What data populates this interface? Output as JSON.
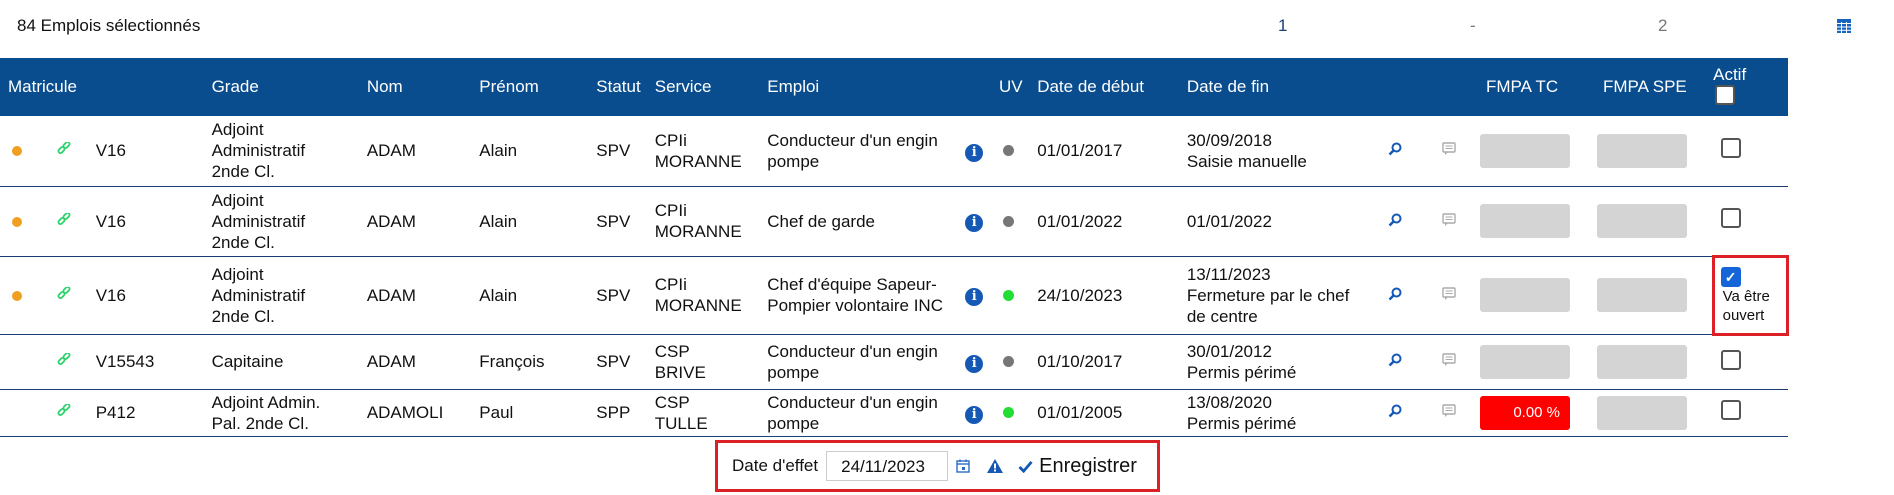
{
  "topbar": {
    "count_label": "84 Emplois sélectionnés",
    "page1": "1",
    "sep": "-",
    "page2": "2"
  },
  "columns": [
    "Matricule",
    "Grade",
    "Nom",
    "Prénom",
    "Statut",
    "Service",
    "Emploi",
    "UV",
    "Date de début",
    "Date de fin",
    "FMPA TC",
    "FMPA SPE",
    "Actif"
  ],
  "rows": [
    {
      "matricule": "V16",
      "grade": "Adjoint Administratif 2nde Cl.",
      "nom": "ADAM",
      "prenom": "Alain",
      "statut": "SPV",
      "service": "CPIi MORANNE",
      "emploi": "Conducteur d'un engin pompe",
      "uv_status": "grey",
      "date_debut": "01/01/2017",
      "date_fin": "30/09/2018",
      "date_fin_note": "Saisie manuelle",
      "fmpa_tc": "",
      "fmpa_spe": "",
      "actif": false
    },
    {
      "matricule": "V16",
      "grade": "Adjoint Administratif 2nde Cl.",
      "nom": "ADAM",
      "prenom": "Alain",
      "statut": "SPV",
      "service": "CPIi MORANNE",
      "emploi": "Chef de garde",
      "uv_status": "grey",
      "date_debut": "01/01/2022",
      "date_fin": "01/01/2022",
      "date_fin_note": "",
      "fmpa_tc": "",
      "fmpa_spe": "",
      "actif": false
    },
    {
      "matricule": "V16",
      "grade": "Adjoint Administratif 2nde Cl.",
      "nom": "ADAM",
      "prenom": "Alain",
      "statut": "SPV",
      "service": "CPIi MORANNE",
      "emploi": "Chef d'équipe Sapeur-Pompier volontaire INC",
      "uv_status": "green",
      "date_debut": "24/10/2023",
      "date_fin": "13/11/2023",
      "date_fin_note": "Fermeture par le chef de centre",
      "fmpa_tc": "",
      "fmpa_spe": "",
      "actif": true,
      "actif_note": "Va être ouvert"
    },
    {
      "matricule": "V15543",
      "grade": "Capitaine",
      "nom": "ADAM",
      "prenom": "François",
      "statut": "SPV",
      "service": "CSP BRIVE",
      "emploi": "Conducteur d'un engin pompe",
      "uv_status": "grey",
      "date_debut": "01/10/2017",
      "date_fin": "30/01/2012",
      "date_fin_note": "Permis périmé",
      "fmpa_tc": "",
      "fmpa_spe": "",
      "actif": false
    },
    {
      "matricule": "P412",
      "grade": "Adjoint Admin. Pal. 2nde Cl.",
      "nom": "ADAMOLI",
      "prenom": "Paul",
      "statut": "SPP",
      "service": "CSP TULLE",
      "emploi": "Conducteur d'un engin pompe",
      "uv_status": "green",
      "date_debut": "01/01/2005",
      "date_fin": "13/08/2020",
      "date_fin_note": "Permis périmé",
      "fmpa_tc": "0.00 %",
      "fmpa_spe": "",
      "actif": false
    }
  ],
  "footer": {
    "date_label": "Date d'effet",
    "date_value": "24/11/2023",
    "save_label": "Enregistrer"
  },
  "colors": {
    "header_bg": "#0a4d8f",
    "highlight": "#dd1f26",
    "status_orange": "#f0a020",
    "uv_green": "#22dd33",
    "fmpa_alert": "#ff0000"
  }
}
